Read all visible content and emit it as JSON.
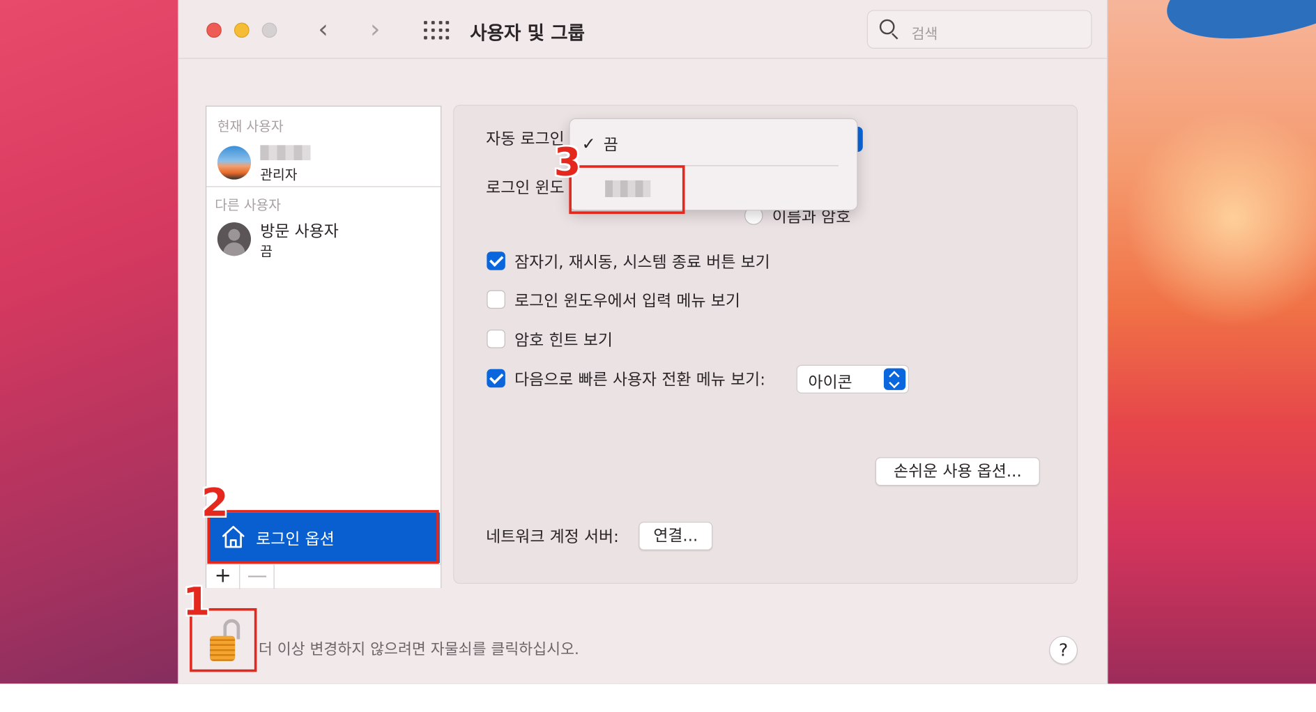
{
  "window": {
    "title": "사용자 및 그룹",
    "search_placeholder": "검색"
  },
  "sidebar": {
    "current_users_label": "현재 사용자",
    "admin": {
      "role": "관리자"
    },
    "other_users_label": "다른 사용자",
    "guest": {
      "name": "방문 사용자",
      "status": "끔"
    },
    "login_options_label": "로그인 옵션",
    "add_label": "+",
    "remove_label": "—"
  },
  "panel": {
    "auto_login_label": "자동 로그인",
    "login_window_label": "로그인 윈도",
    "radio_name_password": "이름과 암호",
    "checkbox_sleep": {
      "label": "잠자기, 재시동, 시스템 종료 버튼 보기",
      "checked": true
    },
    "checkbox_input_menu": {
      "label": "로그인 윈도우에서 입력 메뉴 보기",
      "checked": false
    },
    "checkbox_hint": {
      "label": "암호 힌트 보기",
      "checked": false
    },
    "checkbox_fast_switch": {
      "label": "다음으로 빠른 사용자 전환 메뉴 보기:",
      "checked": true
    },
    "fast_switch_value": "아이콘",
    "accessibility_button": "손쉬운 사용 옵션...",
    "network_server_label": "네트워크 계정 서버:",
    "connect_button": "연결..."
  },
  "dropdown_menu": {
    "checkmark": "✓",
    "selected_item": "끔"
  },
  "footer": {
    "lock_text": "더 이상 변경하지 않으려면 자물쇠를 클릭하십시오.",
    "help_label": "?"
  },
  "annotations": {
    "marker_1": "1",
    "marker_2": "2",
    "marker_3": "3",
    "color": "#e4281e"
  },
  "colors": {
    "accent": "#0a66dc",
    "selection": "#0a5fd0"
  }
}
